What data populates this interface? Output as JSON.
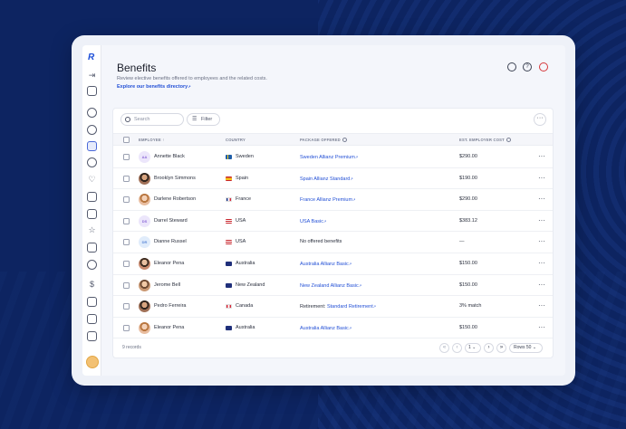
{
  "page": {
    "title": "Benefits",
    "subtitle": "Review elective benefits offered to employees and the related costs.",
    "directory_link": "Explore our benefits directory",
    "external_glyph": "↗"
  },
  "header_actions": [
    {
      "name": "search-icon",
      "glyph": "⌕"
    },
    {
      "name": "help-icon",
      "glyph": "?"
    },
    {
      "name": "bell-icon",
      "glyph": "♪"
    }
  ],
  "toolbar": {
    "search_placeholder": "Search",
    "filter_label": "Filter",
    "more_glyph": "···"
  },
  "table": {
    "columns": {
      "employee": "EMPLOYEE",
      "sort_glyph": "↑",
      "country": "COUNTRY",
      "package": "PACKAGE OFFERED",
      "cost": "EST. EMPLOYER COST"
    },
    "rows": [
      {
        "avatar": "AA",
        "name": "Annette Black",
        "flag": "se",
        "country": "Sweden",
        "package_prefix": "",
        "package": "Sweden Allianz Premium",
        "package_is_link": true,
        "cost": "$290.00"
      },
      {
        "avatar": "photo",
        "name": "Brooklyn Simmons",
        "flag": "es",
        "country": "Spain",
        "package_prefix": "",
        "package": "Spain Allianz Standard",
        "package_is_link": true,
        "cost": "$190.00"
      },
      {
        "avatar": "photo",
        "name": "Darlene Robertson",
        "flag": "fr",
        "country": "France",
        "package_prefix": "",
        "package": "France Allianz Premium",
        "package_is_link": true,
        "cost": "$290.00"
      },
      {
        "avatar": "DS",
        "name": "Darrel Steward",
        "flag": "us",
        "country": "USA",
        "package_prefix": "",
        "package": "USA Basic",
        "package_is_link": true,
        "cost": "$383.12"
      },
      {
        "avatar": "DR",
        "name": "Dianne Russel",
        "flag": "us",
        "country": "USA",
        "package_prefix": "",
        "package": "No offered benefits",
        "package_is_link": false,
        "cost": "—"
      },
      {
        "avatar": "photo",
        "name": "Eleanor Pena",
        "flag": "au",
        "country": "Australia",
        "package_prefix": "",
        "package": "Australia Allianz Basic",
        "package_is_link": true,
        "cost": "$150.00"
      },
      {
        "avatar": "photo",
        "name": "Jerome Bell",
        "flag": "nz",
        "country": "New Zealand",
        "package_prefix": "",
        "package": "New Zealand Allianz Basic",
        "package_is_link": true,
        "cost": "$150.00"
      },
      {
        "avatar": "photo",
        "name": "Pedro Ferreira",
        "flag": "ca",
        "country": "Canada",
        "package_prefix": "Retirement: ",
        "package": "Standard Retirement",
        "package_is_link": true,
        "cost": "3% match"
      },
      {
        "avatar": "photo",
        "name": "Eleanor Pena",
        "flag": "au",
        "country": "Australia",
        "package_prefix": "",
        "package": "Australia Allianz Basic",
        "package_is_link": true,
        "cost": "$150.00"
      }
    ],
    "row_menu_glyph": "···"
  },
  "footer": {
    "records": "9 records",
    "first_glyph": "«",
    "prev_glyph": "‹",
    "page": "1",
    "page_chevron": "⌄",
    "next_glyph": "›",
    "last_glyph": "»",
    "rows_label": "Rows",
    "rows_value": "50"
  },
  "sidebar": {
    "logo": "R",
    "items": [
      "collapse-icon",
      "panel-icon",
      "people-icon",
      "add-person-icon",
      "calendar-icon",
      "clock-icon",
      "heart-icon",
      "document-icon",
      "clipboard-icon",
      "star-icon",
      "chart-icon",
      "chat-icon",
      "dollar-icon",
      "card-icon",
      "file-icon",
      "export-icon"
    ]
  }
}
